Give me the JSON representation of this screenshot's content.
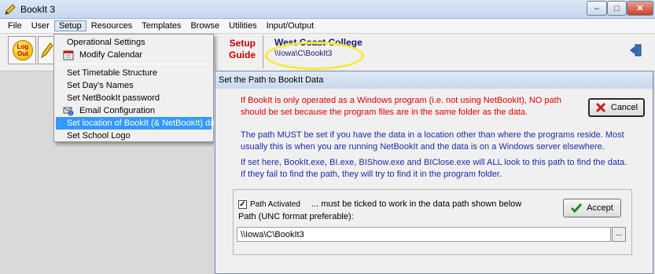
{
  "window": {
    "title": "BookIt 3"
  },
  "menubar": {
    "items": [
      "File",
      "User",
      "Setup",
      "Resources",
      "Templates",
      "Browse",
      "Utilities",
      "Input/Output"
    ]
  },
  "toolbar": {
    "logout_label": "Log Out",
    "setup_guide_line1": "Setup",
    "setup_guide_line2": "Guide",
    "college_name": "West Coast College",
    "data_path": "\\\\Iowa\\C\\BookIt3"
  },
  "setup_menu": {
    "items": [
      "Operational Settings",
      "Modify Calendar",
      "Set Timetable Structure",
      "Set Day's Names",
      "Set NetBookIt password",
      "Email Configuration",
      "Set location of BookIt (& NetBookIt) data",
      "Set School Logo"
    ]
  },
  "dialog": {
    "title": "Set the Path to BookIt Data",
    "warning_line1": "If BookIt is only operated as a Windows program (i.e. not using NetBookIt), NO path",
    "warning_line2": "should be set because the program files are in the same folder as the data.",
    "info1_line1": "The path MUST be set if you have the data in a location other than where the programs reside.  Most",
    "info1_line2": "usually this is when you are running NetBookIt and the data is on a Windows server elsewhere.",
    "info2_line1": "If set here, BookIt.exe, BI.exe, BIShow.exe and BIClose.exe will ALL look to this path to find the data.",
    "info2_line2": "If they fail to find the path, they will try to find it in the program folder.",
    "cancel_label": "Cancel",
    "accept_label": "Accept",
    "checkbox_label": "Path Activated",
    "checkbox_note": "... must be ticked to work in the data path shown below",
    "path_label": "Path (UNC format preferable):",
    "path_value": "\\\\Iowa\\C\\BookIt3",
    "browse_label": "...",
    "path_activated": true
  }
}
